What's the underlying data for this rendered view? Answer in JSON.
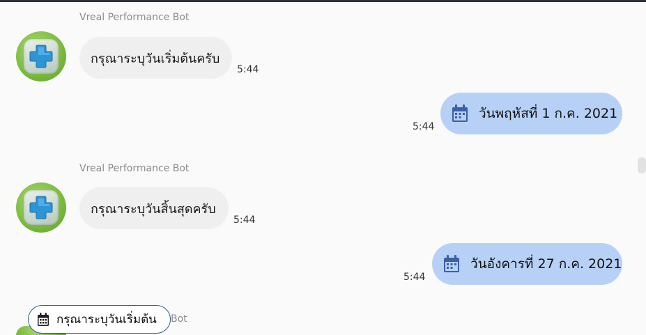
{
  "messages": [
    {
      "type": "bot",
      "sender": "Vreal Performance Bot",
      "text": "กรุณาระบุวันเริ่มต้นครับ",
      "time": "5:44"
    },
    {
      "type": "user",
      "text": "วันพฤหัสที่ 1 ก.ค. 2021",
      "time": "5:44",
      "icon": "calendar-icon"
    },
    {
      "type": "bot",
      "sender": "Vreal Performance Bot",
      "text": "กรุณาระบุวันสิ้นสุดครับ",
      "time": "5:44"
    },
    {
      "type": "user",
      "text": "วันอังคารที่ 27 ก.ค. 2021",
      "time": "5:44",
      "icon": "calendar-icon"
    }
  ],
  "partial_sender": "Bot",
  "quick_reply": {
    "label": "กรุณาระบุวันเริ่มต้น",
    "icon": "calendar-icon"
  },
  "colors": {
    "bot_bubble": "#efefef",
    "user_bubble": "#b6d1f5",
    "calendar_icon": "#3c5fa6",
    "quick_reply_border": "#2f5aa0",
    "avatar_green": "#7cbd3e",
    "avatar_cross": "#2b95d6"
  }
}
